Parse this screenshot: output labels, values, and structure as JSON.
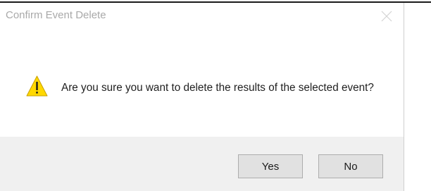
{
  "window": {
    "title": "Confirm Event Delete",
    "close_icon": "close-icon"
  },
  "message": {
    "icon": "warning-icon",
    "text": "Are you sure you want to delete the results of the selected event?"
  },
  "buttons": {
    "yes_label": "Yes",
    "no_label": "No"
  },
  "colors": {
    "warning_fill": "#ffd800",
    "warning_stroke": "#c8a000",
    "footer_bg": "#f0f0f0",
    "button_bg": "#e1e1e1",
    "button_border": "#adadad",
    "title_text": "#a9a9a9"
  }
}
